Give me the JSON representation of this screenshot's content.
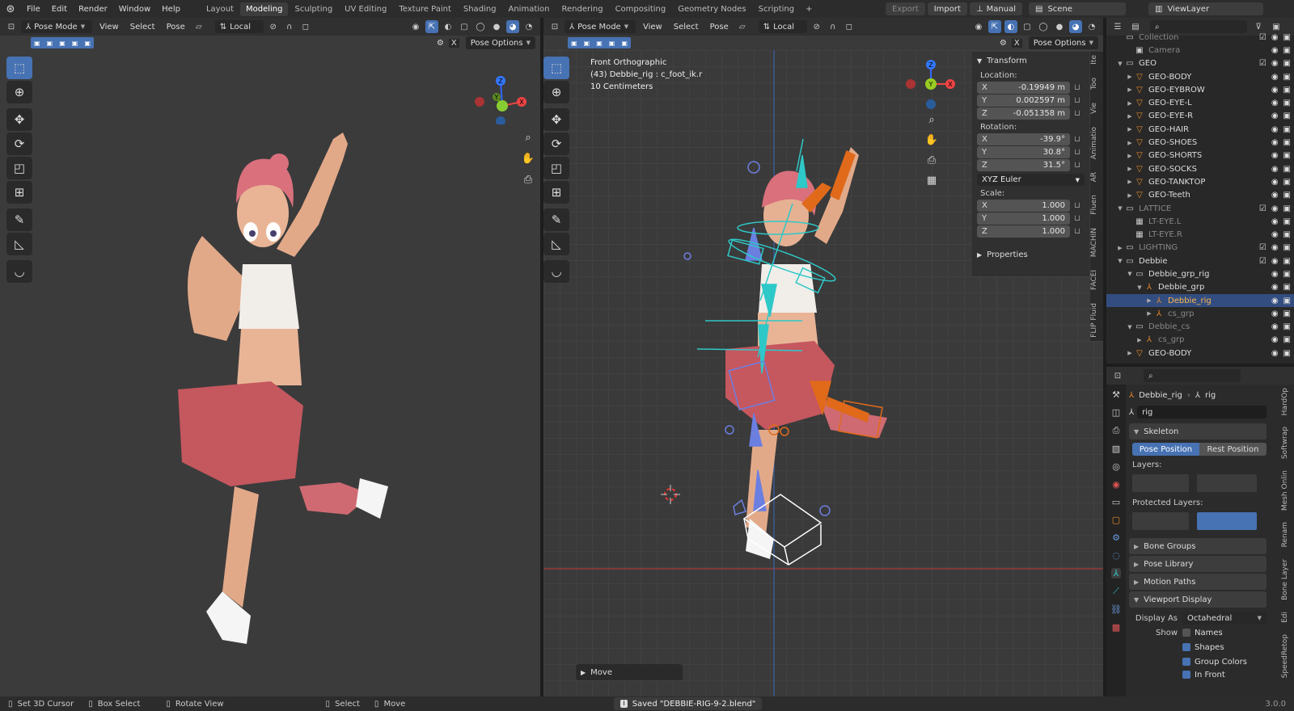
{
  "menu": [
    "File",
    "Edit",
    "Render",
    "Window",
    "Help"
  ],
  "workspaces": [
    {
      "label": "Layout",
      "active": false
    },
    {
      "label": "Modeling",
      "active": true
    },
    {
      "label": "Sculpting",
      "active": false
    },
    {
      "label": "UV Editing",
      "active": false
    },
    {
      "label": "Texture Paint",
      "active": false
    },
    {
      "label": "Shading",
      "active": false
    },
    {
      "label": "Animation",
      "active": false
    },
    {
      "label": "Rendering",
      "active": false
    },
    {
      "label": "Compositing",
      "active": false
    },
    {
      "label": "Geometry Nodes",
      "active": false
    },
    {
      "label": "Scripting",
      "active": false
    }
  ],
  "add_workspace": "+",
  "topright": {
    "export": "Export",
    "import": "Import",
    "manual": "Manual",
    "scene": "Scene",
    "view_layer": "ViewLayer"
  },
  "vp_left": {
    "mode": "Pose Mode",
    "view": "View",
    "select": "Select",
    "pose": "Pose",
    "orientation": "Local",
    "pose_options": "Pose Options",
    "x_label": "X"
  },
  "vp_right": {
    "mode": "Pose Mode",
    "view": "View",
    "select": "Select",
    "pose": "Pose",
    "orientation": "Local",
    "pose_options": "Pose Options",
    "x_label": "X",
    "overlay_title": "Front Orthographic",
    "overlay_object": "(43) Debbie_rig : c_foot_ik.r",
    "overlay_scale": "10 Centimeters",
    "move_panel": "Move"
  },
  "gizmo": {
    "x": "X",
    "y": "Y",
    "z": "Z"
  },
  "npanel": {
    "header": "Transform",
    "location_label": "Location:",
    "location": [
      {
        "axis": "X",
        "value": "-0.19949 m"
      },
      {
        "axis": "Y",
        "value": "0.002597 m"
      },
      {
        "axis": "Z",
        "value": "-0.051358 m"
      }
    ],
    "rotation_label": "Rotation:",
    "rotation": [
      {
        "axis": "X",
        "value": "-39.9°"
      },
      {
        "axis": "Y",
        "value": "30.8°"
      },
      {
        "axis": "Z",
        "value": "31.5°"
      }
    ],
    "rotation_mode": "XYZ Euler",
    "scale_label": "Scale:",
    "scale": [
      {
        "axis": "X",
        "value": "1.000"
      },
      {
        "axis": "Y",
        "value": "1.000"
      },
      {
        "axis": "Z",
        "value": "1.000"
      }
    ],
    "properties": "Properties"
  },
  "npanel_tabs": [
    "Ite",
    "Too",
    "Vie",
    "Animatio",
    "AR",
    "Fluen",
    "MACHIN",
    "FACEI",
    "FLIP Fluid"
  ],
  "outliner": [
    {
      "name": "Collection",
      "depth": 1,
      "icon": "▭",
      "dim": true,
      "tri": ""
    },
    {
      "name": "Camera",
      "depth": 2,
      "icon": "▣",
      "dim": true,
      "tri": ""
    },
    {
      "name": "GEO",
      "depth": 1,
      "icon": "▭",
      "dim": false,
      "tri": "▼"
    },
    {
      "name": "GEO-BODY",
      "depth": 2,
      "icon": "▽",
      "dim": false,
      "tri": "▶"
    },
    {
      "name": "GEO-EYBROW",
      "depth": 2,
      "icon": "▽",
      "dim": false,
      "tri": "▶"
    },
    {
      "name": "GEO-EYE-L",
      "depth": 2,
      "icon": "▽",
      "dim": false,
      "tri": "▶"
    },
    {
      "name": "GEO-EYE-R",
      "depth": 2,
      "icon": "▽",
      "dim": false,
      "tri": "▶"
    },
    {
      "name": "GEO-HAIR",
      "depth": 2,
      "icon": "▽",
      "dim": false,
      "tri": "▶"
    },
    {
      "name": "GEO-SHOES",
      "depth": 2,
      "icon": "▽",
      "dim": false,
      "tri": "▶"
    },
    {
      "name": "GEO-SHORTS",
      "depth": 2,
      "icon": "▽",
      "dim": false,
      "tri": "▶"
    },
    {
      "name": "GEO-SOCKS",
      "depth": 2,
      "icon": "▽",
      "dim": false,
      "tri": "▶"
    },
    {
      "name": "GEO-TANKTOP",
      "depth": 2,
      "icon": "▽",
      "dim": false,
      "tri": "▶"
    },
    {
      "name": "GEO-Teeth",
      "depth": 2,
      "icon": "▽",
      "dim": false,
      "tri": "▶"
    },
    {
      "name": "LATTICE",
      "depth": 1,
      "icon": "▭",
      "dim": true,
      "tri": "▼"
    },
    {
      "name": "LT-EYE.L",
      "depth": 2,
      "icon": "▦",
      "dim": true,
      "tri": ""
    },
    {
      "name": "LT-EYE.R",
      "depth": 2,
      "icon": "▦",
      "dim": true,
      "tri": ""
    },
    {
      "name": "LIGHTING",
      "depth": 1,
      "icon": "▭",
      "dim": true,
      "tri": "▶"
    },
    {
      "name": "Debbie",
      "depth": 1,
      "icon": "▭",
      "dim": false,
      "tri": "▼"
    },
    {
      "name": "Debbie_grp_rig",
      "depth": 2,
      "icon": "▭",
      "dim": false,
      "tri": "▼"
    },
    {
      "name": "Debbie_grp",
      "depth": 3,
      "icon": "⅄",
      "dim": false,
      "tri": "▼"
    },
    {
      "name": "Debbie_rig",
      "depth": 4,
      "icon": "⅄",
      "dim": false,
      "tri": "▶",
      "selected": true
    },
    {
      "name": "cs_grp",
      "depth": 4,
      "icon": "⅄",
      "dim": true,
      "tri": "▶"
    },
    {
      "name": "Debbie_cs",
      "depth": 2,
      "icon": "▭",
      "dim": true,
      "tri": "▼"
    },
    {
      "name": "cs_grp",
      "depth": 3,
      "icon": "⅄",
      "dim": true,
      "tri": "▶"
    },
    {
      "name": "GEO-BODY",
      "depth": 2,
      "icon": "▽",
      "dim": false,
      "tri": "▶"
    }
  ],
  "props": {
    "breadcrumb_obj": "Debbie_rig",
    "breadcrumb_sep": "›",
    "breadcrumb_data": "rig",
    "data_name": "rig",
    "skeleton": "Skeleton",
    "pose_position": "Pose Position",
    "rest_position": "Rest Position",
    "layers": "Layers:",
    "protected_layers": "Protected Layers:",
    "bone_groups": "Bone Groups",
    "pose_library": "Pose Library",
    "motion_paths": "Motion Paths",
    "viewport_display": "Viewport Display",
    "display_as_label": "Display As",
    "display_as": "Octahedral",
    "show_label": "Show",
    "show_names": "Names",
    "show_shapes": "Shapes",
    "show_group_colors": "Group Colors",
    "show_in_front": "In Front"
  },
  "props_tabs": [
    "HardOp",
    "Softwrap",
    "Mesh Onlin",
    "Renam",
    "Bone Layer",
    "Edi",
    "SpeedRetop"
  ],
  "status": {
    "set_cursor": "Set 3D Cursor",
    "box_select": "Box Select",
    "rotate_view": "Rotate View",
    "select": "Select",
    "move": "Move",
    "saved": "Saved \"DEBBIE-RIG-9-2.blend\"",
    "version": "3.0.0"
  },
  "colors": {
    "accent": "#4772b3",
    "header": "#303030",
    "viewport": "#3a3a3a",
    "bone_cyan": "#2fc8c8",
    "bone_orange": "#e06a1a",
    "bone_blue": "#6b7fe0"
  }
}
